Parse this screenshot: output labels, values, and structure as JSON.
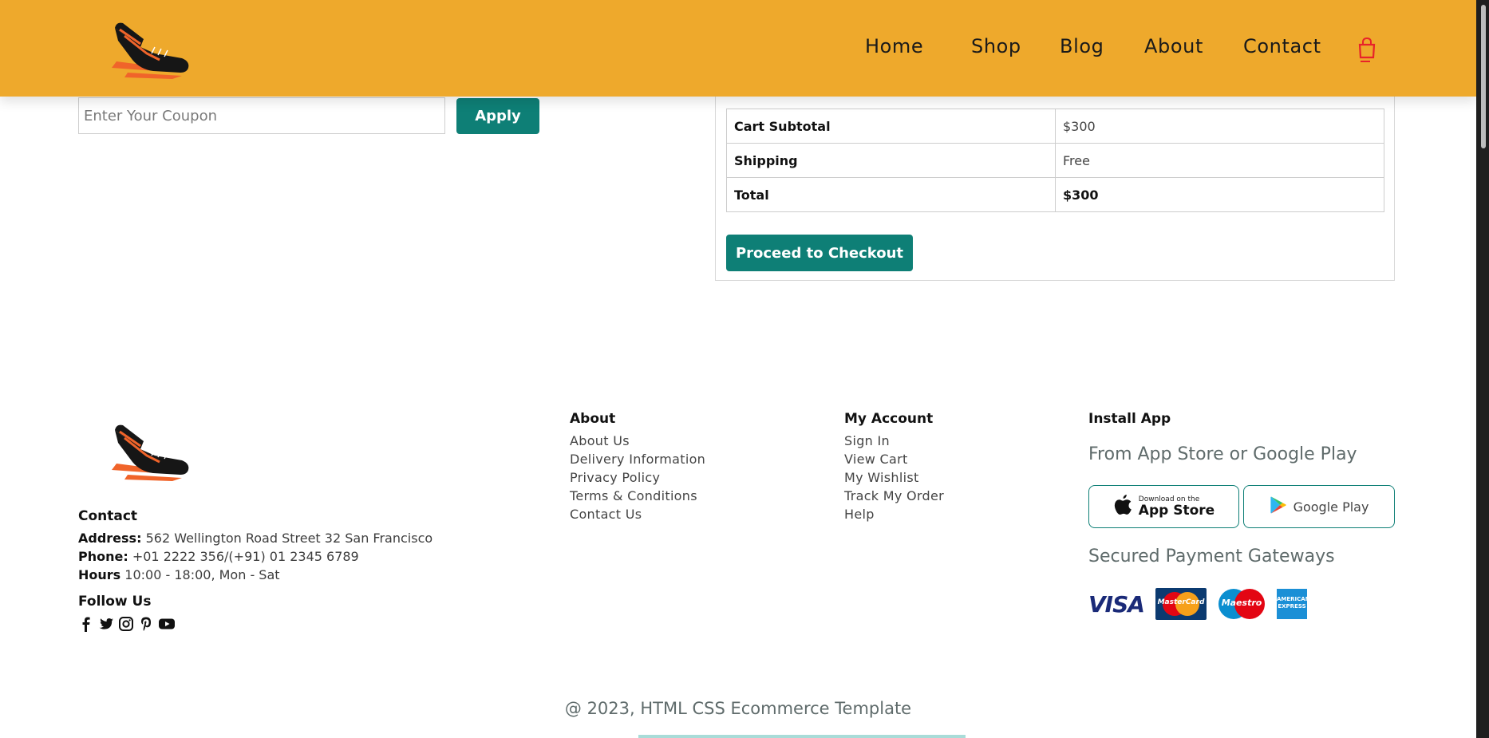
{
  "nav": {
    "items": [
      "Home",
      "Shop",
      "Blog",
      "About",
      "Contact"
    ]
  },
  "coupon": {
    "placeholder": "Enter Your Coupon",
    "apply_label": "Apply"
  },
  "totals": {
    "rows": [
      {
        "label": "Cart Subtotal",
        "value": "$300"
      },
      {
        "label": "Shipping",
        "value": "Free"
      },
      {
        "label": "Total",
        "value": "$300"
      }
    ],
    "checkout_label": "Proceed to Checkout"
  },
  "footer": {
    "contact": {
      "title": "Contact",
      "address_label": "Address:",
      "address_value": "562 Wellington Road Street 32 San Francisco",
      "phone_label": "Phone:",
      "phone_value": "+01 2222 356/(+91) 01 2345 6789",
      "hours_label": "Hours",
      "hours_value": "10:00 - 18:00, Mon - Sat",
      "follow_title": "Follow Us",
      "social_icons": [
        "facebook-icon",
        "twitter-icon",
        "instagram-icon",
        "pinterest-icon",
        "youtube-icon"
      ]
    },
    "about": {
      "title": "About",
      "links": [
        "About Us",
        "Delivery Information",
        "Privacy Policy",
        "Terms & Conditions",
        "Contact Us"
      ]
    },
    "account": {
      "title": "My Account",
      "links": [
        "Sign In",
        "View Cart",
        "My Wishlist",
        "Track My Order",
        "Help"
      ]
    },
    "app": {
      "title": "Install App",
      "subtitle": "From App Store or Google Play",
      "appstore_small": "Download on the",
      "appstore_big": "App Store",
      "googleplay": "Google Play",
      "payments_title": "Secured Payment Gateways",
      "payments": [
        "VISA",
        "MasterCard",
        "Maestro",
        "AMERICAN EXPRESS"
      ]
    },
    "copyright": "@ 2023, HTML CSS Ecommerce Template"
  },
  "colors": {
    "header_bg": "#eea92c",
    "accent_teal": "#0e7f76",
    "cart_red": "#e8232a",
    "shoe_orange": "#f0642a"
  }
}
